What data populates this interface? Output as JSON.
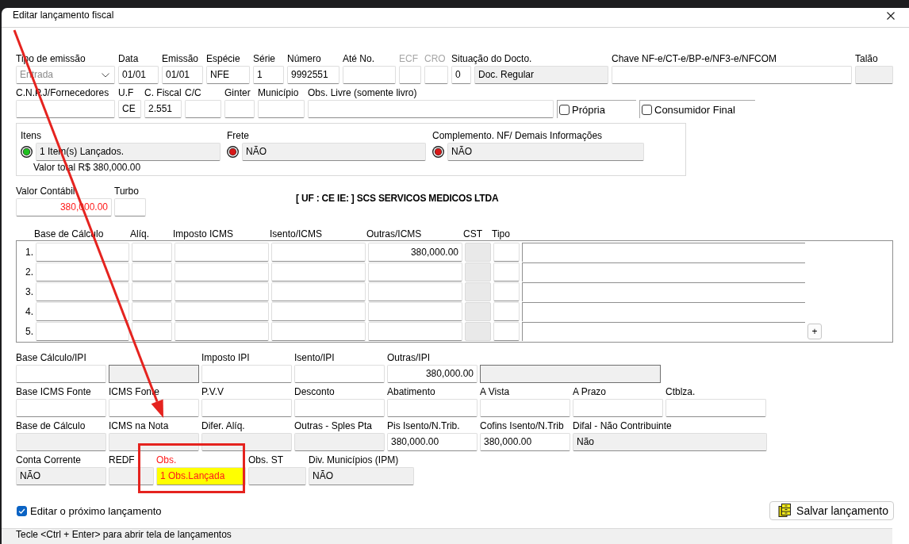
{
  "window": {
    "title": "Editar lançamento fiscal"
  },
  "header_rows": [
    [
      {
        "kind": "combo",
        "label": "Tipo de emissão",
        "value": "Entrada",
        "disabled": true,
        "dimmed": false
      },
      {
        "kind": "text",
        "label": "Data",
        "value": "01/01",
        "disabled": false,
        "dimmed": false
      },
      {
        "kind": "text",
        "label": "Emissão",
        "value": "01/01",
        "disabled": false,
        "dimmed": false
      },
      {
        "kind": "text",
        "label": "Espécie",
        "value": "NFE",
        "disabled": false,
        "dimmed": false
      },
      {
        "kind": "text",
        "label": "Série",
        "value": "1",
        "disabled": false,
        "dimmed": false
      },
      {
        "kind": "text",
        "label": "Número",
        "value": "9992551",
        "disabled": false,
        "dimmed": false
      },
      {
        "kind": "text",
        "label": "Até No.",
        "disabled": false,
        "dimmed": false
      },
      {
        "kind": "text",
        "label": "ECF",
        "disabled": false,
        "dimmed": true
      },
      {
        "kind": "text",
        "label": "CRO",
        "disabled": false,
        "dimmed": true
      },
      {
        "kind": "pair",
        "label": "Situação do Docto.",
        "dimmed": false,
        "parts": [
          {
            "value": "0",
            "disabled": false
          },
          {
            "value": "Doc. Regular",
            "disabled": true
          }
        ]
      },
      {
        "kind": "text",
        "label": "Chave NF-e/CT-e/BP-e/NF3-e/NFCOM",
        "disabled": false,
        "dimmed": false
      },
      {
        "kind": "text",
        "label": "Talão",
        "disabled": true,
        "dimmed": false
      }
    ],
    [
      {
        "kind": "text",
        "label": "C.N.P.J/Fornecedores",
        "disabled": false,
        "dimmed": false
      },
      {
        "kind": "text",
        "label": "U.F",
        "value": "CE",
        "disabled": false,
        "dimmed": false
      },
      {
        "kind": "text",
        "label": "C. Fiscal",
        "value": "2.551",
        "disabled": false,
        "dimmed": false
      },
      {
        "kind": "text",
        "label": "C/C",
        "disabled": false,
        "dimmed": false
      },
      {
        "kind": "text",
        "label": "Ginter",
        "disabled": false,
        "dimmed": false
      },
      {
        "kind": "text",
        "label": "Município",
        "disabled": false,
        "dimmed": false
      },
      {
        "kind": "text",
        "label": "Obs. Livre (somente livro)",
        "disabled": false,
        "dimmed": false
      },
      {
        "kind": "checkbox",
        "label": "Própria",
        "checked": false,
        "disabled": false,
        "dimmed": false
      },
      {
        "kind": "checkbox",
        "label": "Consumidor Final",
        "checked": false,
        "disabled": false,
        "dimmed": false
      }
    ]
  ],
  "document_panel": {
    "items": [
      {
        "label": "Itens",
        "value": "1 Item(s) Lançados.",
        "color": "#1fbf1f",
        "disabled": true
      },
      {
        "label": "Frete",
        "value": "NÃO",
        "color": "#d81818",
        "disabled": true
      },
      {
        "label": "Complemento. NF/ Demais Informações",
        "value": "NÃO",
        "color": "#d81818",
        "disabled": true
      }
    ],
    "total": "Valor total R$ 380,000.00"
  },
  "value_row": {
    "fields": [
      {
        "label": "Valor Contábil",
        "value": "380,000.00",
        "highlighted": true
      },
      {
        "label": "Turbo"
      }
    ],
    "company": "[ UF : CE IE: ] SCS SERVICOS MEDICOS LTDA"
  },
  "icms_table": {
    "columns": [
      {
        "label": "Base de Cálculo",
        "disabled": false
      },
      {
        "label": "Alíq.",
        "disabled": false
      },
      {
        "label": "Imposto ICMS",
        "disabled": false
      },
      {
        "label": "Isento/ICMS",
        "disabled": false
      },
      {
        "label": "Outras/ICMS",
        "disabled": false
      },
      {
        "label": "CST",
        "disabled": true
      },
      {
        "label": "Tipo",
        "disabled": false
      },
      {
        "disabled": false
      }
    ],
    "rows": [
      {
        "number": "1.",
        "outras_icms": "380,000.00"
      },
      {
        "number": "2."
      },
      {
        "number": "3."
      },
      {
        "number": "4."
      },
      {
        "number": "5."
      }
    ],
    "add_button": "+"
  },
  "fiscal_rows": [
    [
      {
        "label": "Base Cálculo/IPI",
        "disabled": false,
        "highlighted": false
      },
      {
        "disabled": true,
        "highlighted": false
      },
      {
        "label": "Imposto IPI",
        "disabled": false,
        "highlighted": false
      },
      {
        "label": "Isento/IPI",
        "disabled": false,
        "highlighted": false
      },
      {
        "label": "Outras/IPI",
        "value": "380,000.00",
        "disabled": false,
        "highlighted": false
      },
      {
        "disabled": true,
        "highlighted": false
      }
    ],
    [
      {
        "label": "Base ICMS Fonte",
        "disabled": false,
        "highlighted": false
      },
      {
        "label": "ICMS Fonte",
        "disabled": false,
        "highlighted": false
      },
      {
        "label": "P.V.V",
        "disabled": false,
        "highlighted": false
      },
      {
        "label": "Desconto",
        "disabled": false,
        "highlighted": false
      },
      {
        "label": "Abatimento",
        "disabled": false,
        "highlighted": false
      },
      {
        "label": "A Vista",
        "disabled": false,
        "highlighted": false
      },
      {
        "label": "A Prazo",
        "disabled": false,
        "highlighted": false
      },
      {
        "label": "Ctblza.",
        "disabled": false,
        "highlighted": false
      }
    ],
    [
      {
        "label": "Base de Cálculo",
        "disabled": true,
        "highlighted": false
      },
      {
        "label": "ICMS na Nota",
        "disabled": true,
        "highlighted": false
      },
      {
        "label": "Difer. Alíq.",
        "disabled": true,
        "highlighted": false
      },
      {
        "label": "Outras - Sples Pta",
        "disabled": true,
        "highlighted": false
      },
      {
        "label": "Pis Isento/N.Trib.",
        "value": "380,000.00",
        "disabled": false,
        "highlighted": false
      },
      {
        "label": "Cofins Isento/N.Trib",
        "value": "380,000.00",
        "disabled": false,
        "highlighted": false
      },
      {
        "label": "Difal - Não Contribuinte",
        "value": "Não",
        "disabled": true,
        "highlighted": false
      }
    ],
    [
      {
        "label": "Conta Corrente",
        "value": "NÃO",
        "disabled": true,
        "highlighted": false
      },
      {
        "label": "REDF",
        "disabled": true,
        "highlighted": false
      },
      {
        "label": "Obs.",
        "value": "1 Obs.Lançada",
        "disabled": false,
        "highlighted": true
      },
      {
        "label": "Obs. ST",
        "disabled": true,
        "highlighted": false
      },
      {
        "label": "Div. Municípios (IPM)",
        "value": "NÃO",
        "disabled": true,
        "highlighted": false
      }
    ]
  ],
  "next_entry": {
    "label": "Editar o próximo lançamento",
    "checked": true
  },
  "save_button": {
    "label": "Salvar lançamento"
  },
  "status_bar": {
    "text": "Tecle <Ctrl + Enter> para abrir tela de lançamentos"
  },
  "annotations": [
    {
      "kind": "arrow"
    },
    {
      "kind": "frame"
    }
  ]
}
